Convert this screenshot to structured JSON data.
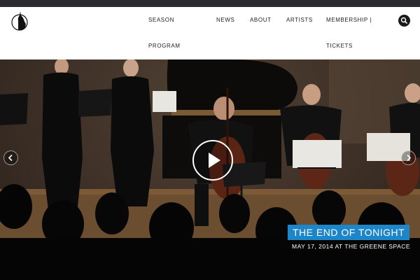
{
  "nav": {
    "season": "SEASON",
    "program": "PROGRAM",
    "news": "NEWS",
    "about": "ABOUT",
    "artists": "ARTISTS",
    "membership": "MEMBERSHIP |",
    "tickets": "TICKETS"
  },
  "icons": {
    "logo": "logo-silhouette-icon",
    "search": "search-icon",
    "prev": "chevron-left-icon",
    "next": "chevron-right-icon",
    "play": "play-icon"
  },
  "hero": {
    "title": "THE END OF TONIGHT",
    "subtitle": "MAY 17, 2014 AT THE GREENE SPACE"
  },
  "colors": {
    "accent": "#1c86c8",
    "header_bg": "#ffffff",
    "top_strip": "#2b2b30"
  }
}
